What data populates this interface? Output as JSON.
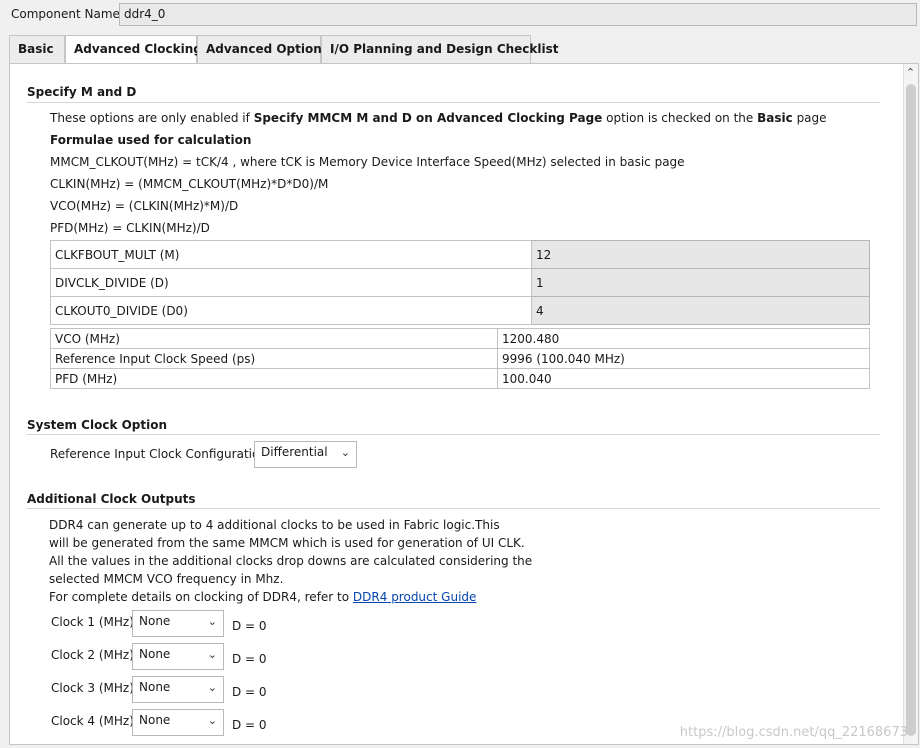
{
  "component": {
    "label": "Component Name",
    "value": "ddr4_0"
  },
  "tabs": [
    {
      "label": "Basic"
    },
    {
      "label": "Advanced Clocking"
    },
    {
      "label": "Advanced Options"
    },
    {
      "label": "I/O Planning and Design Checklist"
    }
  ],
  "mmcm": {
    "title": "Specify M and D",
    "note_prefix": "These options are only enabled if",
    "note_bold": "Specify MMCM M and D on Advanced Clocking Page",
    "note_mid": "option is checked on the",
    "note_bold2": "Basic",
    "note_suffix": "page",
    "formulae_title": "Formulae used for calculation",
    "formulae": [
      "MMCM_CLKOUT(MHz) = tCK/4 , where tCK is Memory Device Interface Speed(MHz) selected in basic page",
      "CLKIN(MHz) = (MMCM_CLKOUT(MHz)*D*D0)/M",
      "VCO(MHz) = (CLKIN(MHz)*M)/D",
      "PFD(MHz) = CLKIN(MHz)/D"
    ],
    "params": [
      {
        "label": "CLKFBOUT_MULT (M)",
        "value": "12"
      },
      {
        "label": "DIVCLK_DIVIDE (D)",
        "value": "1"
      },
      {
        "label": "CLKOUT0_DIVIDE (D0)",
        "value": "4"
      }
    ],
    "results": [
      {
        "label": "VCO (MHz)",
        "value": "1200.480"
      },
      {
        "label": "Reference Input Clock Speed (ps)",
        "value": "9996 (100.040 MHz)"
      },
      {
        "label": "PFD (MHz)",
        "value": "100.040"
      }
    ]
  },
  "system_clock": {
    "title": "System Clock Option",
    "label": "Reference Input Clock Configuration",
    "value": "Differential"
  },
  "additional": {
    "title": "Additional Clock Outputs",
    "lines": [
      "DDR4 can generate up to 4 additional clocks to be used in Fabric logic.This",
      "will be generated from the same MMCM which is used for generation of UI CLK.",
      "All the values in the additional clocks drop downs are calculated considering the",
      "selected MMCM VCO frequency in Mhz."
    ],
    "guide_prefix": "For complete details on clocking of DDR4, refer to",
    "guide_link": "DDR4 product Guide",
    "clocks": [
      {
        "label": "Clock 1 (MHz)",
        "value": "None",
        "d": "D = 0"
      },
      {
        "label": "Clock 2 (MHz)",
        "value": "None",
        "d": "D = 0"
      },
      {
        "label": "Clock 3 (MHz)",
        "value": "None",
        "d": "D = 0"
      },
      {
        "label": "Clock 4 (MHz)",
        "value": "None",
        "d": "D = 0"
      }
    ]
  },
  "watermark": "https://blog.csdn.net/qq_22168673"
}
